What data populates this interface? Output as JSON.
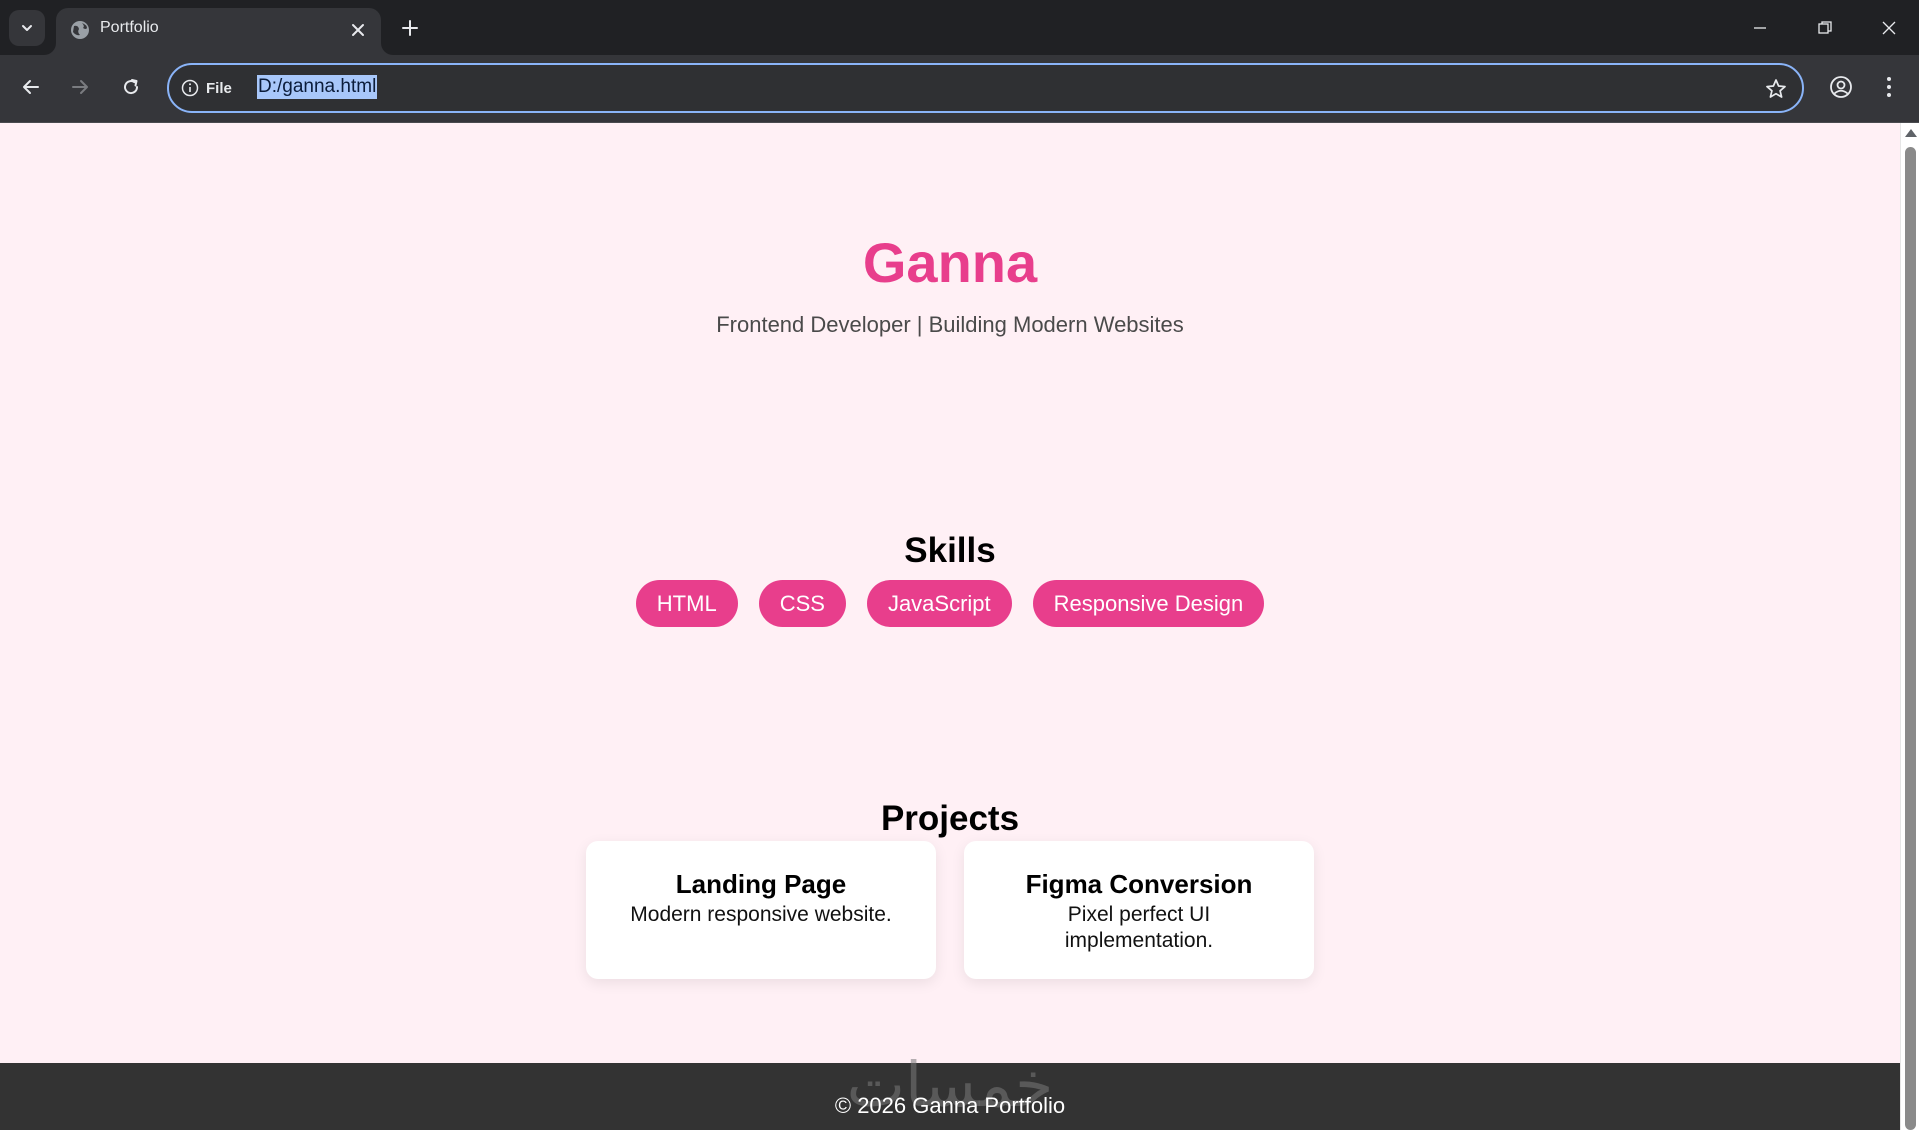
{
  "browser": {
    "tab_title": "Portfolio",
    "site_info_label": "File",
    "url": "D:/ganna.html",
    "icons": {
      "tab_search": "chevron-down-icon",
      "favicon": "globe-icon",
      "tab_close": "close-icon",
      "new_tab": "plus-icon",
      "back": "arrow-left-icon",
      "forward": "arrow-right-icon",
      "reload": "reload-icon",
      "site_info": "info-icon",
      "bookmark": "star-icon",
      "profile": "profile-icon",
      "menu": "kebab-menu-icon"
    }
  },
  "page": {
    "hero": {
      "title": "Ganna",
      "subtitle": "Frontend Developer | Building Modern Websites"
    },
    "skills": {
      "title": "Skills",
      "items": [
        "HTML",
        "CSS",
        "JavaScript",
        "Responsive Design"
      ]
    },
    "projects": {
      "title": "Projects",
      "items": [
        {
          "title": "Landing Page",
          "desc": "Modern responsive website."
        },
        {
          "title": "Figma Conversion",
          "desc": "Pixel perfect UI implementation."
        }
      ]
    },
    "footer": {
      "text": "© 2026 Ganna Portfolio",
      "watermark": "خمسات"
    }
  },
  "colors": {
    "accent": "#e83e8c",
    "page_bg": "#fff0f5",
    "footer_bg": "#333333",
    "browser_bg": "#202124"
  }
}
